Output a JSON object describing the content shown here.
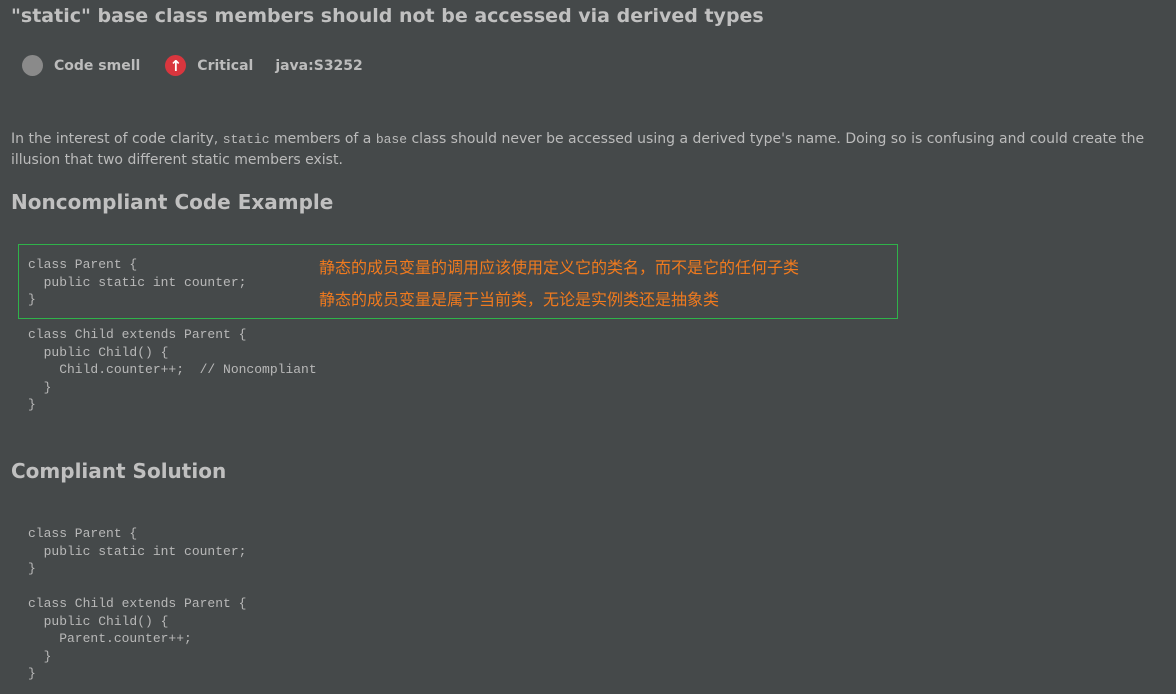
{
  "title": "\"static\" base class members should not be accessed via derived types",
  "meta": {
    "type": "Code smell",
    "severity": "Critical",
    "rule": "java:S3252"
  },
  "description": {
    "p1": "In the interest of code clarity, ",
    "c1": "static",
    "p2": " members of a ",
    "c2": "base",
    "p3": " class should never be accessed using a derived type's name. Doing so is confusing and could create the illusion that two different static members exist."
  },
  "noncompliant": {
    "heading": "Noncompliant Code Example",
    "code1": "class Parent {\n  public static int counter;\n}",
    "code2": "class Child extends Parent {\n  public Child() {\n    Child.counter++;  // Noncompliant\n  }\n}"
  },
  "annotations": [
    "静态的成员变量的调用应该使用定义它的类名，而不是它的任何子类",
    "静态的成员变量是属于当前类，无论是实例类还是抽象类"
  ],
  "compliant": {
    "heading": "Compliant Solution",
    "code": "class Parent {\n  public static int counter;\n}\n\nclass Child extends Parent {\n  public Child() {\n    Parent.counter++;\n  }\n}"
  }
}
